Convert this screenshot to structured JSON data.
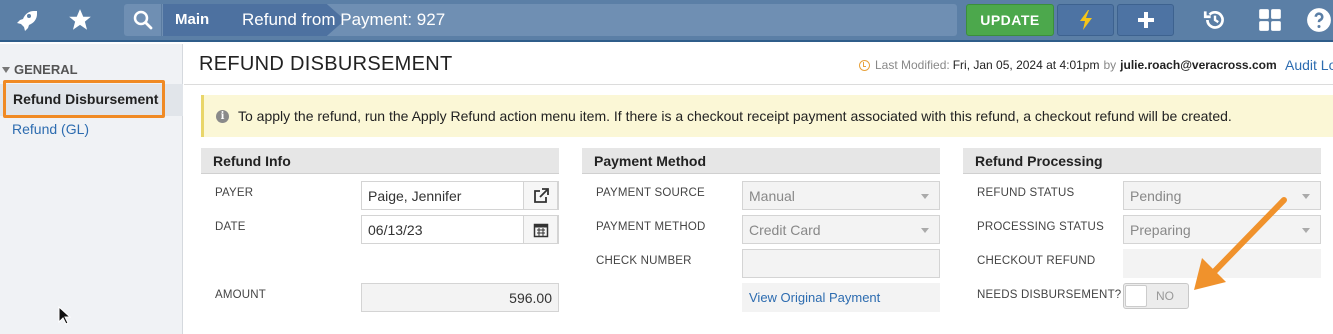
{
  "topbar": {
    "breadcrumb_main": "Main",
    "page_title": "Refund from Payment: 927",
    "update_label": "UPDATE"
  },
  "sidebar": {
    "group_label": "GENERAL",
    "items": [
      {
        "label": "Refund Disbursement",
        "active": true
      },
      {
        "label": "Refund (GL)",
        "active": false
      }
    ]
  },
  "header": {
    "title": "REFUND DISBURSEMENT",
    "last_modified_label": "Last Modified:",
    "last_modified_value": "Fri, Jan 05, 2024 at 4:01pm",
    "by_label": "by",
    "modified_by": "julie.roach@veracross.com",
    "audit_link": "Audit Log"
  },
  "banner": {
    "text": "To apply the refund, run the Apply Refund action menu item. If there is a checkout receipt payment associated with this refund, a checkout refund will be created."
  },
  "refund_info": {
    "title": "Refund Info",
    "payer_label": "PAYER",
    "payer_value": "Paige, Jennifer",
    "date_label": "DATE",
    "date_value": "06/13/23",
    "amount_label": "AMOUNT",
    "amount_value": "596.00"
  },
  "payment_method": {
    "title": "Payment Method",
    "source_label": "PAYMENT SOURCE",
    "source_value": "Manual",
    "method_label": "PAYMENT METHOD",
    "method_value": "Credit Card",
    "check_label": "CHECK NUMBER",
    "check_value": "",
    "view_link": "View Original Payment"
  },
  "refund_processing": {
    "title": "Refund Processing",
    "status_label": "REFUND STATUS",
    "status_value": "Pending",
    "processing_label": "PROCESSING STATUS",
    "processing_value": "Preparing",
    "checkout_label": "CHECKOUT REFUND",
    "checkout_value": "",
    "needs_label": "NEEDS DISBURSEMENT?",
    "needs_value": "NO"
  },
  "colors": {
    "topbar": "#5b7fa6",
    "update_button": "#4ca84c",
    "highlight": "#f08a24",
    "link": "#2d6cb0",
    "banner": "#fbf7d6"
  },
  "icons": [
    "rocket-icon",
    "star-icon",
    "search-icon",
    "lightning-icon",
    "plus-icon",
    "history-icon",
    "grid-icon",
    "help-icon",
    "external-link-icon",
    "calendar-icon",
    "info-icon",
    "clock-icon"
  ]
}
